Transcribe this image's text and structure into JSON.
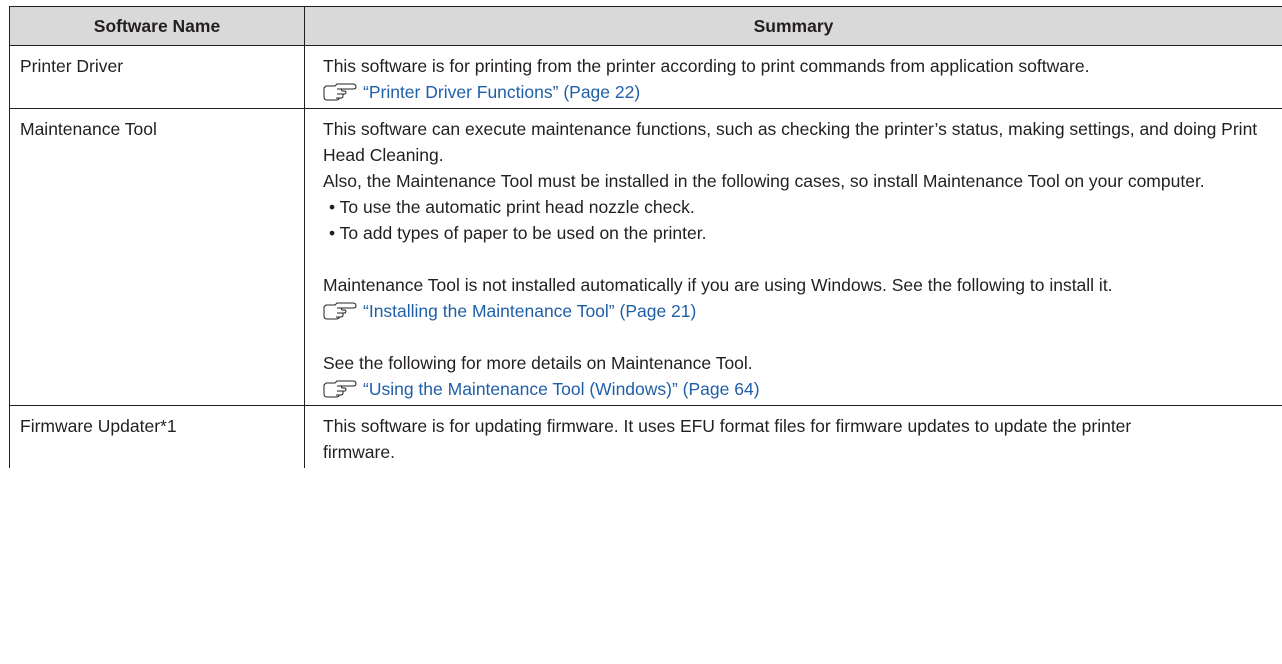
{
  "table": {
    "headers": {
      "name": "Software Name",
      "summary": "Summary"
    },
    "rows": [
      {
        "name": "Printer Driver",
        "summary": {
          "p1": "This software is for printing from the printer according to print commands from application software.",
          "ref1": "“Printer Driver Functions” (Page 22)"
        }
      },
      {
        "name": "Maintenance Tool",
        "summary": {
          "p1": "This software can execute maintenance functions, such as checking the printer’s status, making settings, and doing Print Head Cleaning.",
          "p2": "Also, the Maintenance Tool must be installed in the following cases, so install Maintenance Tool on your computer.",
          "bullets": [
            "• To use the automatic print head nozzle check.",
            "• To add types of paper to be used on the printer."
          ],
          "p3": "Maintenance Tool is not installed automatically if you are using Windows. See the following to install it.",
          "ref1": "“Installing the Maintenance Tool” (Page 21)",
          "p4": "See the following for more details on Maintenance Tool.",
          "ref2": "“Using the Maintenance Tool (Windows)” (Page 64)"
        }
      },
      {
        "name": "Firmware Updater*1",
        "summary": {
          "p1": "This software is for updating firmware. It uses EFU format files for firmware updates to update the printer firmware."
        }
      }
    ]
  },
  "icons": {
    "reference": "pointing-hand-icon",
    "link_color": "#1f5fa8",
    "header_bg": "#d9d9d9"
  }
}
